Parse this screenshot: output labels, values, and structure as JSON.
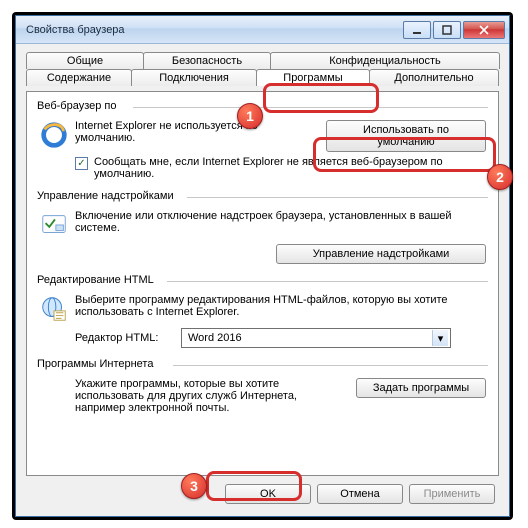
{
  "window": {
    "title": "Свойства браузера"
  },
  "tabs": {
    "row1": [
      "Общие",
      "Безопасность",
      "Конфиденциальность"
    ],
    "row2": [
      "Содержание",
      "Подключения",
      "Программы",
      "Дополнительно"
    ],
    "active": "Программы"
  },
  "browser": {
    "group": "Веб-браузер по",
    "text": "Internet Explorer не используется по умолчанию.",
    "default_btn": "Использовать по умолчанию",
    "notify_label": "Сообщать мне, если Internet Explorer не является веб-браузером по умолчанию.",
    "notify_checked": true
  },
  "addons": {
    "group": "Управление надстройками",
    "text": "Включение или отключение надстроек браузера, установленных в вашей системе.",
    "btn": "Управление надстройками"
  },
  "htmledit": {
    "group": "Редактирование HTML",
    "text": "Выберите программу редактирования HTML-файлов, которую вы хотите использовать с Internet Explorer.",
    "label": "Редактор HTML:",
    "value": "Word 2016"
  },
  "internet": {
    "group": "Программы Интернета",
    "text": "Укажите программы, которые вы хотите использовать для других служб Интернета, например электронной почты.",
    "btn": "Задать программы"
  },
  "footer": {
    "ok": "OK",
    "cancel": "Отмена",
    "apply": "Применить"
  }
}
